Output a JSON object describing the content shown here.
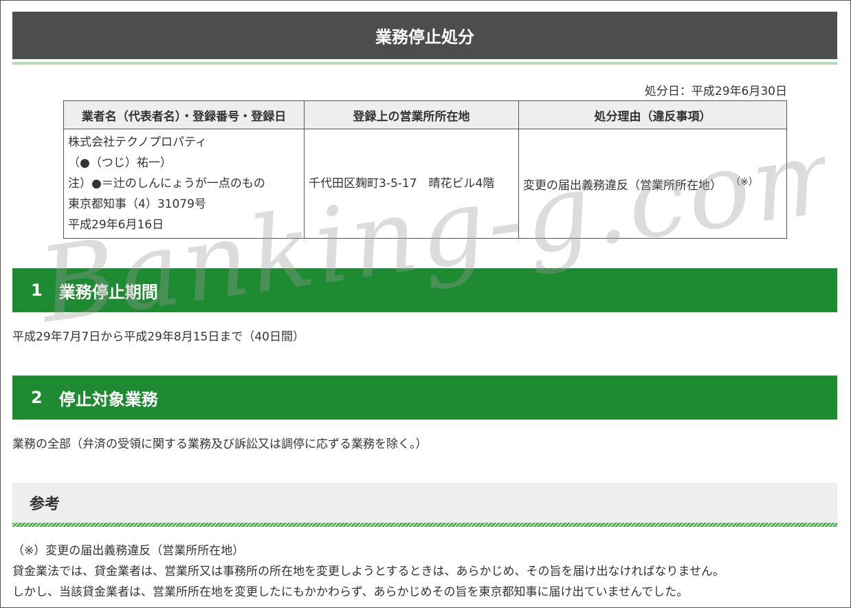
{
  "title": "業務停止処分",
  "disposition_date": "処分日：平成29年6月30日",
  "table": {
    "headers": [
      "業者名（代表者名）・登録番号・登録日",
      "登録上の営業所所在地",
      "処分理由（違反事項）"
    ],
    "business": {
      "lines": [
        "株式会社テクノプロパティ",
        "（●（つじ）祐一）",
        "注）●＝辻のしんにょうが一点のもの",
        "東京都知事（4）31079号",
        "平成29年6月16日"
      ]
    },
    "address": "千代田区麹町3-5-17　晴花ビル4階",
    "reason": "変更の届出義務違反（営業所所在地）",
    "reason_note": "（※）"
  },
  "section1": {
    "number": "1",
    "heading": "業務停止期間",
    "body": "平成29年7月7日から平成29年8月15日まで（40日間）"
  },
  "section2": {
    "number": "2",
    "heading": "停止対象業務",
    "body": "業務の全部（弁済の受領に関する業務及び訴訟又は調停に応ずる業務を除く。）"
  },
  "reference": {
    "heading": "参考",
    "lines": [
      "（※）変更の届出義務違反（営業所所在地）",
      "貸金業法では、貸金業者は、営業所又は事務所の所在地を変更しようとするときは、あらかじめ、その旨を届け出なければなりません。",
      "しかし、当該貸金業者は、営業所所在地を変更したにもかかわらず、あらかじめその旨を東京都知事に届け出ていませんでした。"
    ]
  },
  "watermark": "Banking-g.com",
  "colors": {
    "title_bar": "#4d4d4d",
    "section_bar": "#1e8a32",
    "reference_bar": "#eeeeee"
  }
}
